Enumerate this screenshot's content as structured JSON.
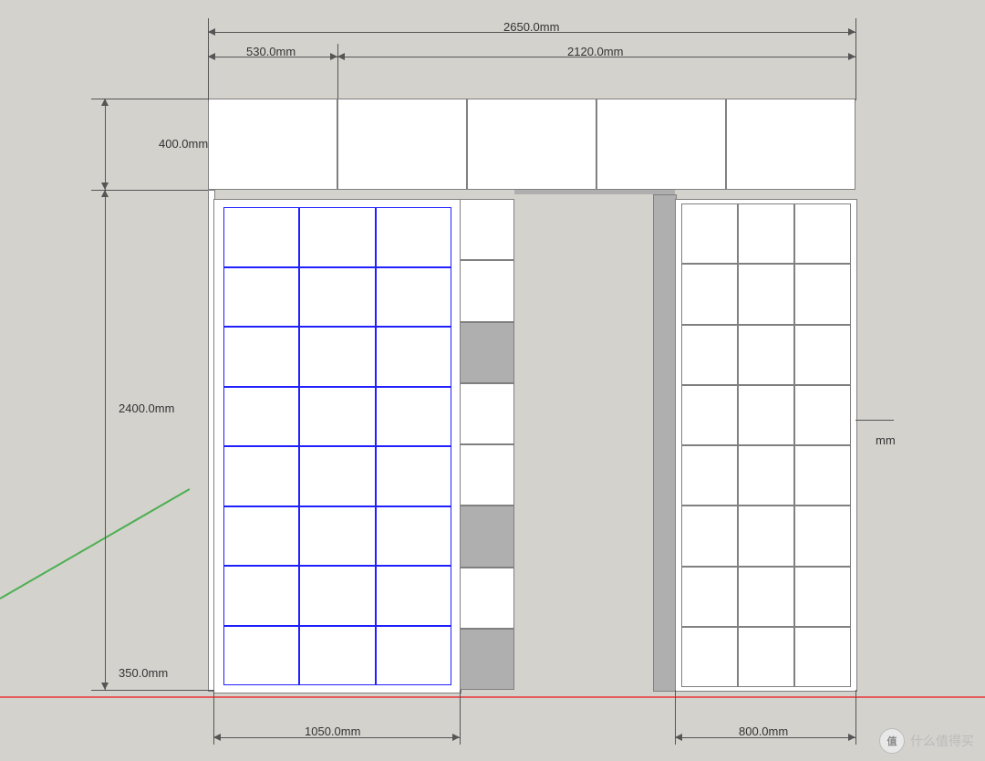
{
  "dimensions": {
    "width_total": "2650.0mm",
    "width_left_top": "530.0mm",
    "width_right_top": "2120.0mm",
    "height_top_section": "400.0mm",
    "height_main": "2400.0mm",
    "height_base": "350.0mm",
    "width_bottom_left": "1050.0mm",
    "width_bottom_right": "800.0mm",
    "right_unit": "mm"
  },
  "watermark": "什么值得买",
  "watermark_badge": "值",
  "geometry": {
    "top_cells": 5,
    "left_shelf_rows": 8,
    "left_door_grid_rows": 8,
    "left_door_grid_cols": 3,
    "right_grid_rows": 8,
    "right_grid_cols": 3
  }
}
